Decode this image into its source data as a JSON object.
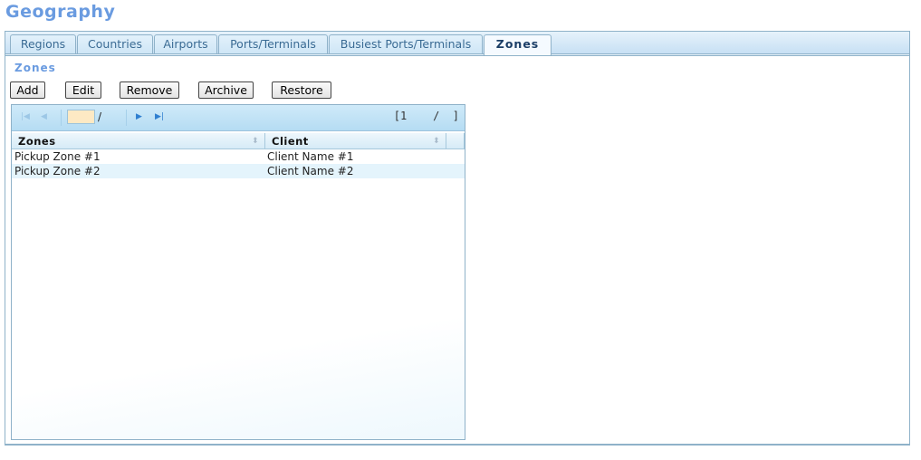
{
  "page": {
    "title": "Geography"
  },
  "tabs": [
    {
      "label": "Regions",
      "active": false
    },
    {
      "label": "Countries",
      "active": false
    },
    {
      "label": "Airports",
      "active": false
    },
    {
      "label": "Ports/Terminals",
      "active": false
    },
    {
      "label": "Busiest Ports/Terminals",
      "active": false
    },
    {
      "label": "Zones",
      "active": true
    }
  ],
  "section": {
    "label": "Zones"
  },
  "toolbar": {
    "add_label": "Add",
    "edit_label": "Edit",
    "remove_label": "Remove",
    "archive_label": "Archive",
    "restore_label": "Restore"
  },
  "pager": {
    "first_icon": "first-page-icon",
    "prev_icon": "prev-page-icon",
    "next_icon": "next-page-icon",
    "last_icon": "last-page-icon",
    "page_value": "",
    "slash": "/",
    "status": "[1    /  ]"
  },
  "grid": {
    "columns": [
      {
        "label": "Zones"
      },
      {
        "label": "Client"
      }
    ],
    "rows": [
      {
        "zone": "Pickup Zone #1",
        "client": "Client Name #1"
      },
      {
        "zone": "Pickup Zone #2",
        "client": "Client Name #2"
      }
    ]
  }
}
